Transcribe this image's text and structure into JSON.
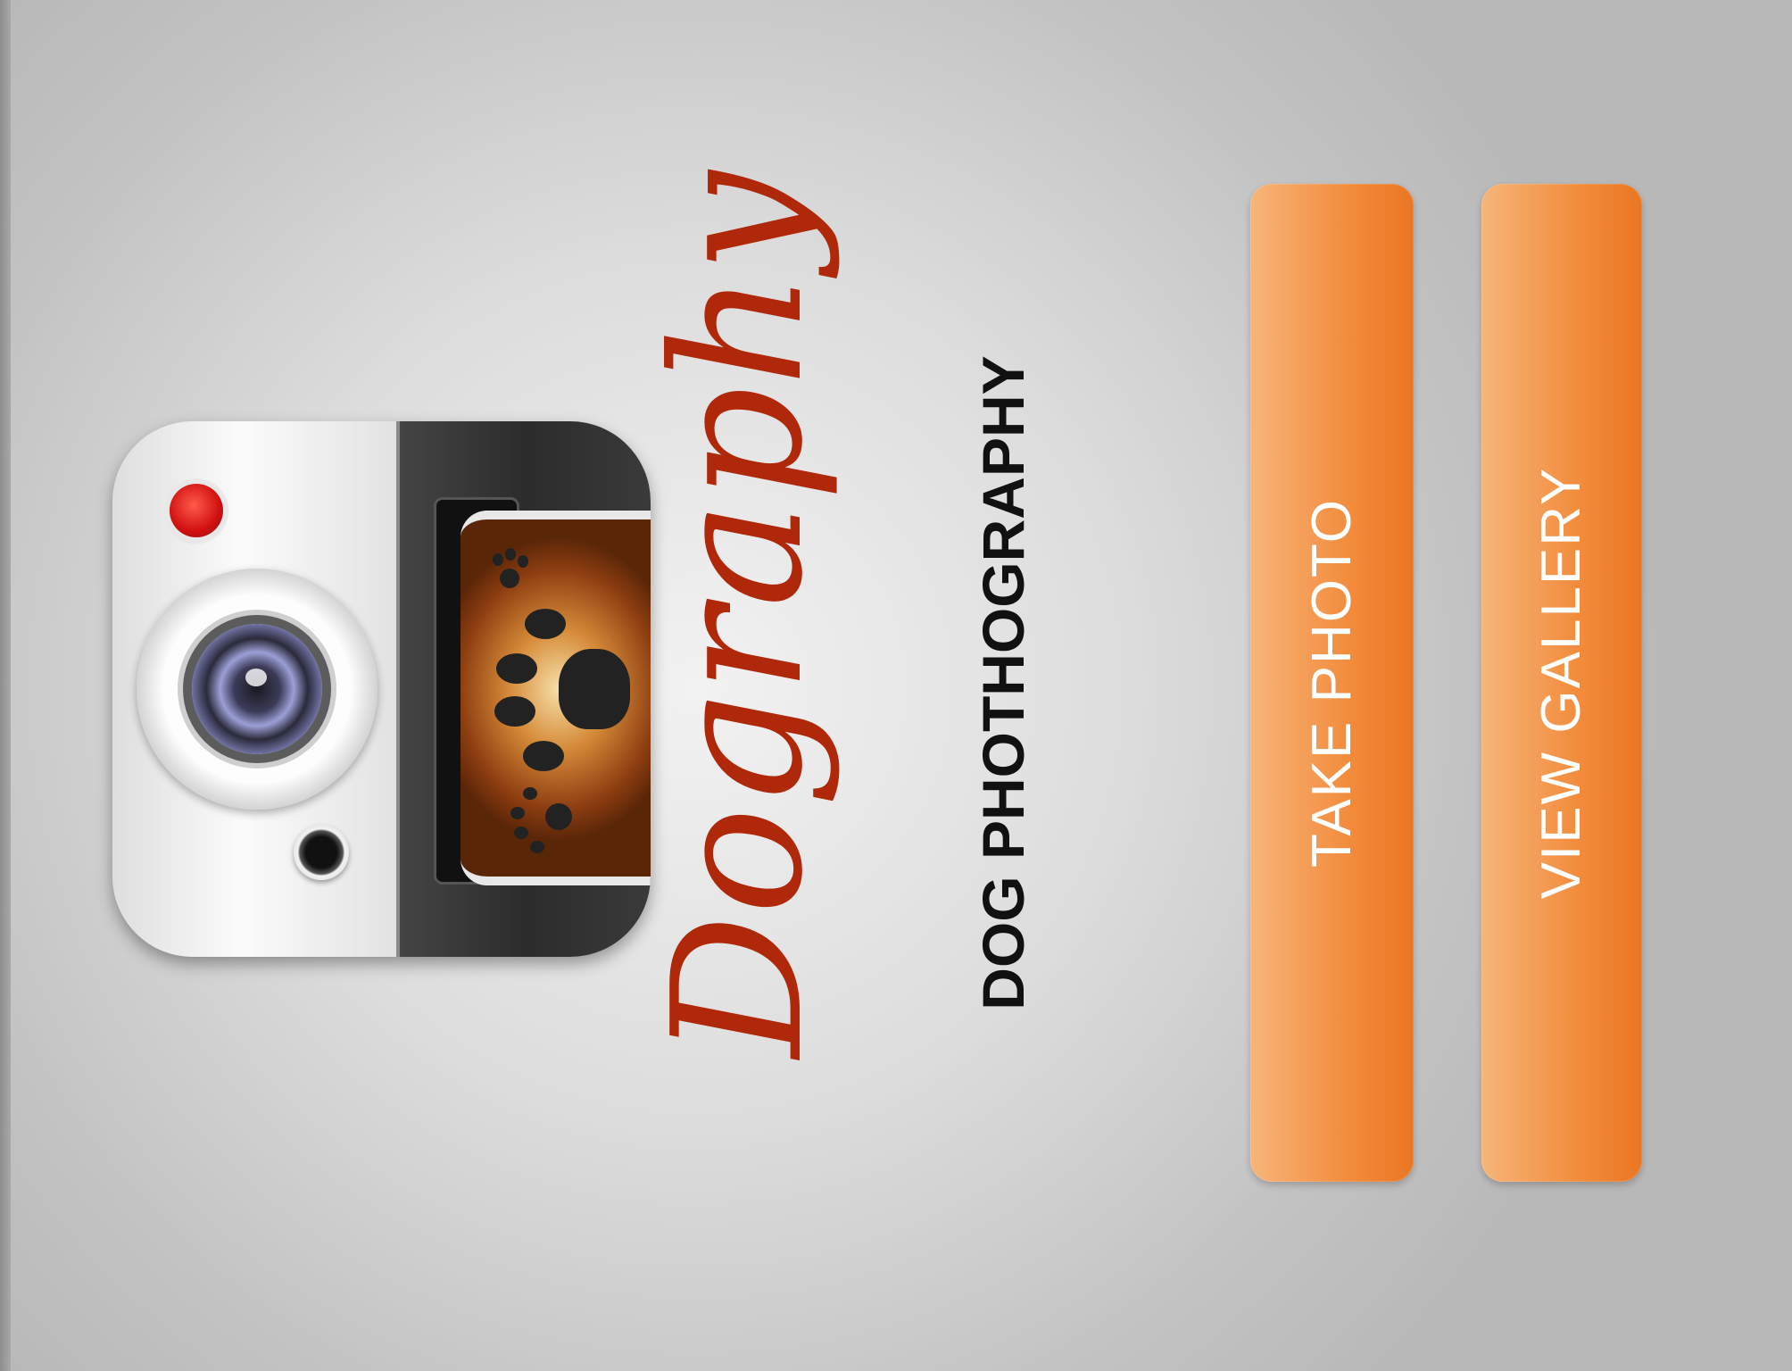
{
  "brand": {
    "title": "Dography",
    "subtitle": "DOG PHOTHOGRAPHY"
  },
  "icon": {
    "name": "camera-app-icon"
  },
  "buttons": {
    "take_photo": "TAKE PHOTO",
    "view_gallery": "VIEW GALLERY"
  },
  "colors": {
    "brand_red": "#b0280a",
    "button_orange": "#f28c3c",
    "button_text": "#ffffff"
  }
}
